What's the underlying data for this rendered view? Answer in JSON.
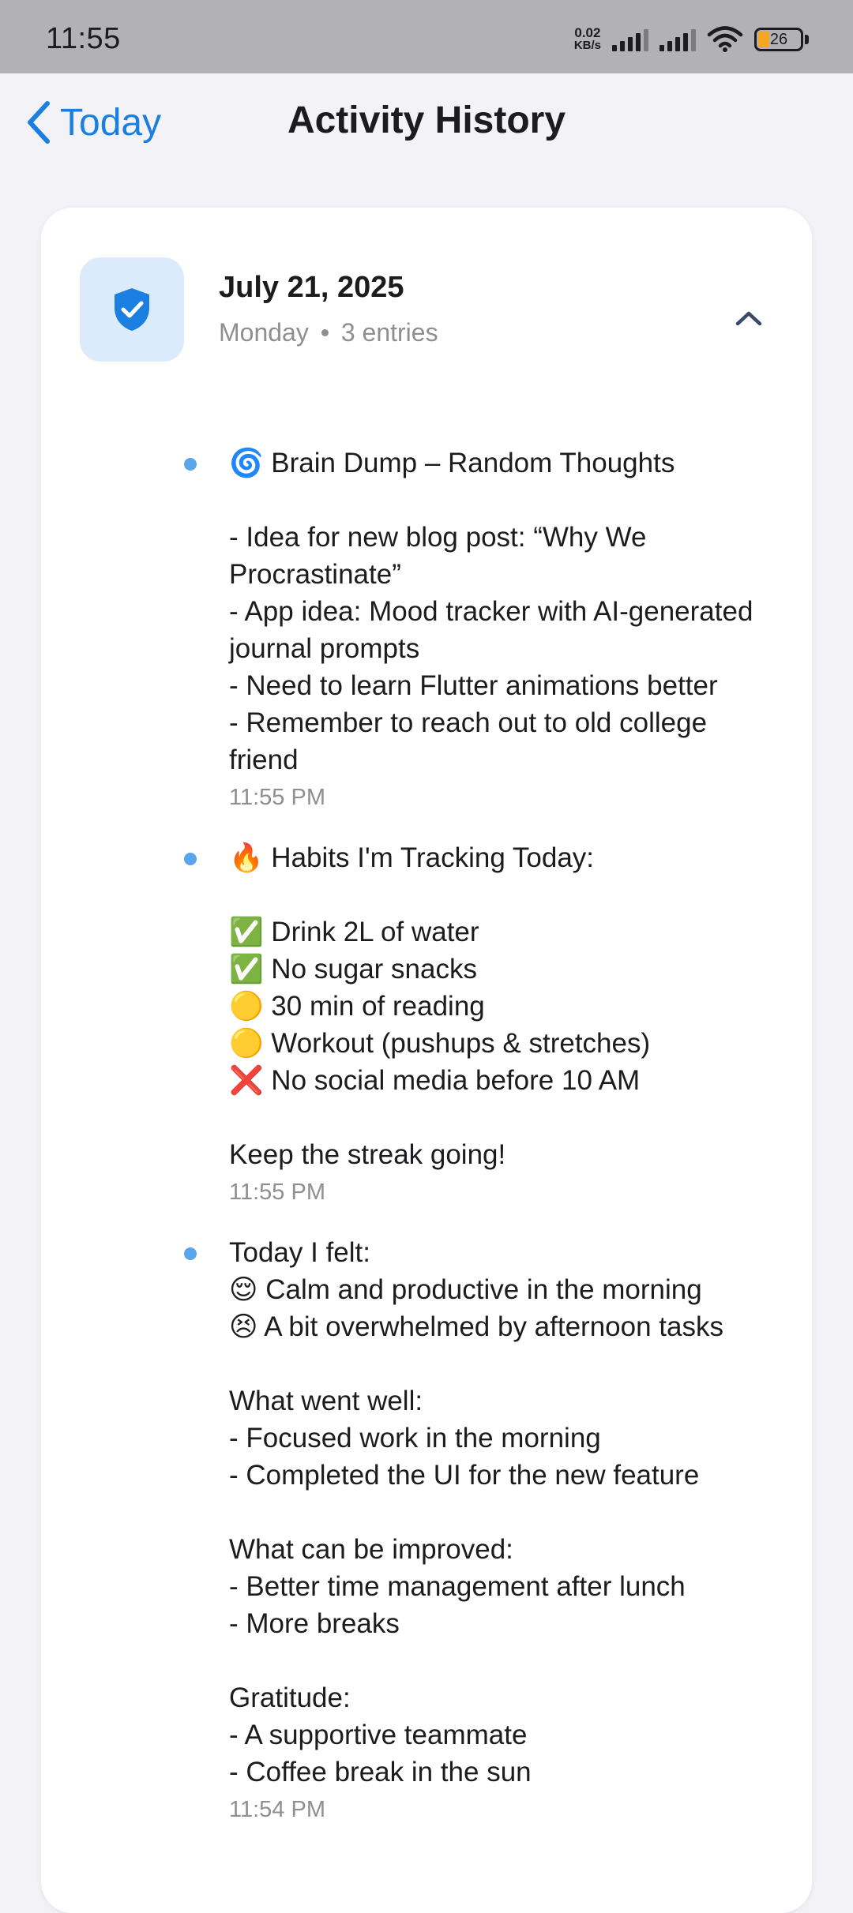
{
  "status_bar": {
    "time": "11:55",
    "net_speed_value": "0.02",
    "net_speed_unit": "KB/s",
    "battery_percent": "26",
    "battery_level": 0.26,
    "icons": [
      "signal-icon",
      "signal-icon",
      "wifi-icon",
      "battery-icon"
    ]
  },
  "nav": {
    "back_label": "Today",
    "title": "Activity History"
  },
  "day": {
    "date": "July 21, 2025",
    "weekday": "Monday",
    "entry_count": "3 entries",
    "icon": "shield-check-icon",
    "collapse_icon": "chevron-up-icon"
  },
  "entries": [
    {
      "text": "🌀 Brain Dump – Random Thoughts\n\n- Idea for new blog post: “Why We Procrastinate”\n- App idea: Mood tracker with AI-generated journal prompts\n- Need to learn Flutter animations better\n- Remember to reach out to old college friend",
      "time": "11:55 PM"
    },
    {
      "text": "🔥 Habits I'm Tracking Today:\n\n✅ Drink 2L of water\n✅ No sugar snacks\n🟡 30 min of reading\n🟡 Workout (pushups & stretches)\n❌ No social media before 10 AM\n\nKeep the streak going!",
      "time": "11:55 PM"
    },
    {
      "text": "Today I felt:\n😌 Calm and productive in the morning\n😣 A bit overwhelmed by afternoon tasks\n\nWhat went well:\n- Focused work in the morning\n- Completed the UI for the new feature\n\nWhat can be improved:\n- Better time management after lunch\n- More breaks\n\nGratitude:\n- A supportive teammate\n- Coffee break in the sun",
      "time": "11:54 PM"
    }
  ],
  "colors": {
    "accent": "#1a7fe0",
    "dot": "#5aa6ec",
    "status_bar": "#b1b1b6",
    "background": "#f2f2f7",
    "shield_bg": "#dcebfb",
    "battery_fill": "#f5a623"
  }
}
